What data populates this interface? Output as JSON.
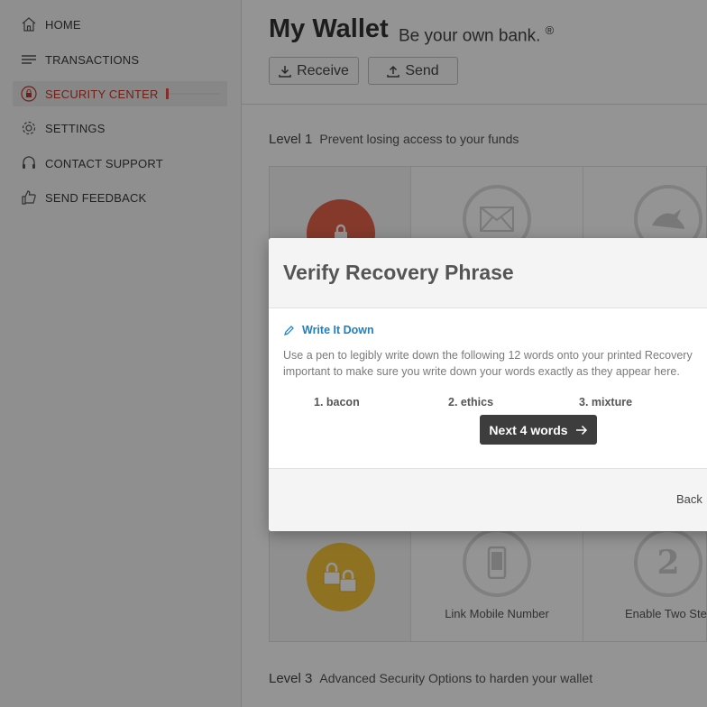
{
  "sidebar": {
    "items": [
      {
        "label": "HOME",
        "icon": "home-icon"
      },
      {
        "label": "TRANSACTIONS",
        "icon": "list-icon"
      },
      {
        "label": "SECURITY CENTER",
        "icon": "lock-icon",
        "active": true,
        "progress": 0.05
      },
      {
        "label": "SETTINGS",
        "icon": "gear-icon"
      },
      {
        "label": "CONTACT SUPPORT",
        "icon": "headset-icon"
      },
      {
        "label": "SEND FEEDBACK",
        "icon": "thumbs-up-icon"
      }
    ]
  },
  "header": {
    "title": "My Wallet",
    "tagline": "Be your own bank.",
    "tagline_mark": "®",
    "receive_label": "Receive",
    "send_label": "Send"
  },
  "levels": [
    {
      "name": "Level 1",
      "description": "Prevent losing access to your funds"
    },
    {
      "name": "Level 3",
      "description": "Advanced Security Options to harden your wallet"
    }
  ],
  "level2_items": [
    {
      "label": "",
      "icon": "padlocks-icon"
    },
    {
      "label": "Link Mobile Number",
      "icon": "mobile-phone-icon"
    },
    {
      "label": "Enable Two Step",
      "icon": "two-step-icon"
    }
  ],
  "modal": {
    "title": "Verify Recovery Phrase",
    "step_title": "Write It Down",
    "instruction_line1": "Use a pen to legibly write down the following 12 words onto your printed Recovery",
    "instruction_line2": "important to make sure you write down your words exactly as they appear here.",
    "words": [
      "1. bacon",
      "2. ethics",
      "3. mixture"
    ],
    "next_label": "Next 4 words",
    "back_label": "Back"
  },
  "colors": {
    "accent_red": "#e04d4d",
    "link_blue": "#1f7fbf",
    "lock_red": "#e4624a",
    "lock_yellow": "#f5c43b"
  }
}
